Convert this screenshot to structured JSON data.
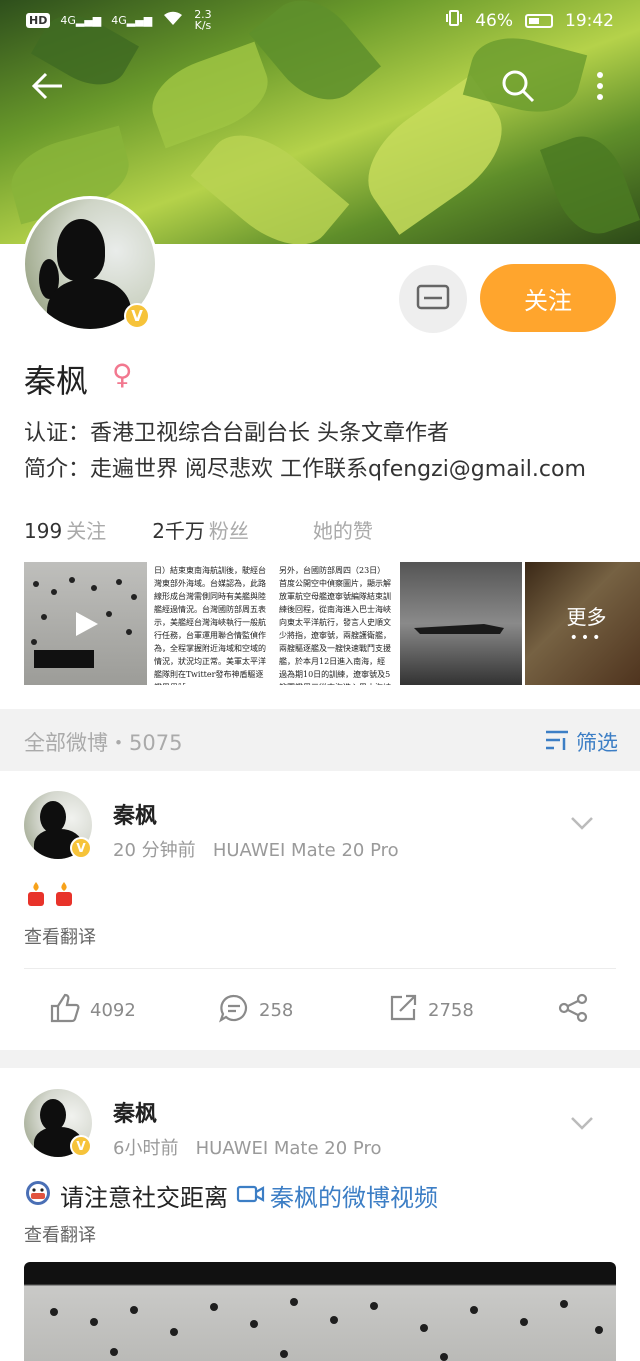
{
  "status_bar": {
    "hd": "HD",
    "net1": "4G",
    "net2": "4G",
    "speed": "2.3",
    "speed_unit": "K/s",
    "battery": "46%",
    "time": "19:42"
  },
  "profile": {
    "name": "秦枫",
    "certification": "认证：香港卫视综合台副台长 头条文章作者",
    "bio": "简介：走遍世界 阅尽悲欢 工作联系qfengzi@gmail.com",
    "follow_label": "关注",
    "stats": {
      "following_num": "199",
      "following_label": "关注",
      "fans_num": "2千万",
      "fans_label": "粉丝",
      "likes_label": "她的赞"
    },
    "more_photos_label": "更多",
    "photo_text_1": "日）結束東南海航訓後，駛經台灣東部外海域。台媒認為，此路線形成台灣需側同時有美艦與陸艦經過情況。台灣國防部周五表示，美艦經台灣海峽執行一般航行任務，台軍運用聯合情監偵作為，全程掌握附近海域和空域的情況，狀況均正常。美軍太平洋艦隊則在Twitter發布神盾驅逐艦巴里號",
    "photo_text_2": "另外，台國防部周四（23日）首度公開空中偵察圖片，顯示解放軍航空母艦遼寧號編隊結束訓練後回程，從南海進入巴士海峽向東太平洋航行，發言人史順文少將指，遼寧號，兩艘護衛艦，兩艘驅逐艦及一艘快速戰鬥支援艦，於本月12日進入南海，經過為期10日的訓練，遼寧號及5艘軍艦周三從南海進入巴士海峽向東（太平洋）航行。"
  },
  "feed_bar": {
    "all_label": "全部微博・5075",
    "filter_label": "筛选"
  },
  "posts": [
    {
      "author": "秦枫",
      "time": "20 分钟前",
      "device": "HUAWEI Mate 20 Pro",
      "text": "",
      "translate": "查看翻译",
      "likes": "4092",
      "comments": "258",
      "reposts": "2758"
    },
    {
      "author": "秦枫",
      "time": "6小时前",
      "device": "HUAWEI Mate 20 Pro",
      "text": "请注意社交距离",
      "video_link": "秦枫的微博视频",
      "translate": "查看翻译"
    }
  ],
  "colors": {
    "accent_orange": "#ffa52d",
    "link_blue": "#3c7ec5",
    "verified_gold": "#f6c33a"
  }
}
